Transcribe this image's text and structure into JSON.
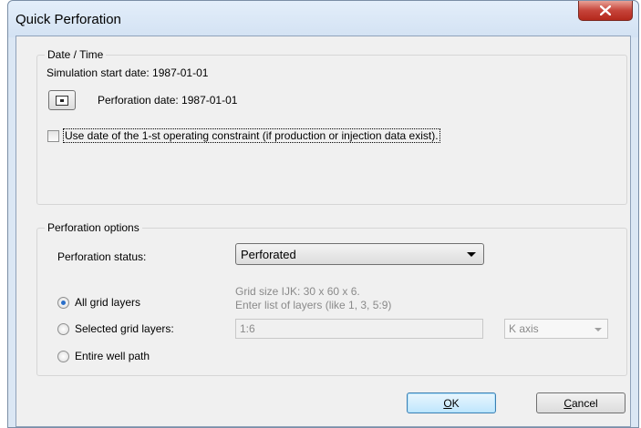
{
  "window": {
    "title": "Quick Perforation"
  },
  "datetime": {
    "legend": "Date / Time",
    "start_date_text": "Simulation start date: 1987-01-01",
    "perf_date_text": "Perforation date: 1987-01-01",
    "use_date_label": "Use date of the 1-st operating constraint  (if production or injection data exist).",
    "use_date_checked": false
  },
  "options": {
    "legend": "Perforation options",
    "status_label": "Perforation status:",
    "status_value": "Perforated",
    "grid_hint_1": "Grid size IJK: 30 x 60 x 6.",
    "grid_hint_2": "Enter list of layers (like 1, 3,  5:9)",
    "radio_all": "All grid layers",
    "radio_selected": "Selected grid layers:",
    "radio_well": "Entire well path",
    "selected_radio": "all",
    "layers_value": "1:6",
    "axis_value": "K axis"
  },
  "buttons": {
    "ok_first": "O",
    "ok_rest": "K",
    "cancel_first": "C",
    "cancel_rest": "ancel"
  },
  "colors": {
    "titlebar": "#dbe7f4",
    "dialog_bg": "#f0f0f0",
    "close": "#c6443a",
    "radio_selected": "#2a6fc9"
  },
  "icons": {
    "close": "close-icon",
    "date_picker": "calendar-icon",
    "dropdown": "chevron-down-icon"
  }
}
